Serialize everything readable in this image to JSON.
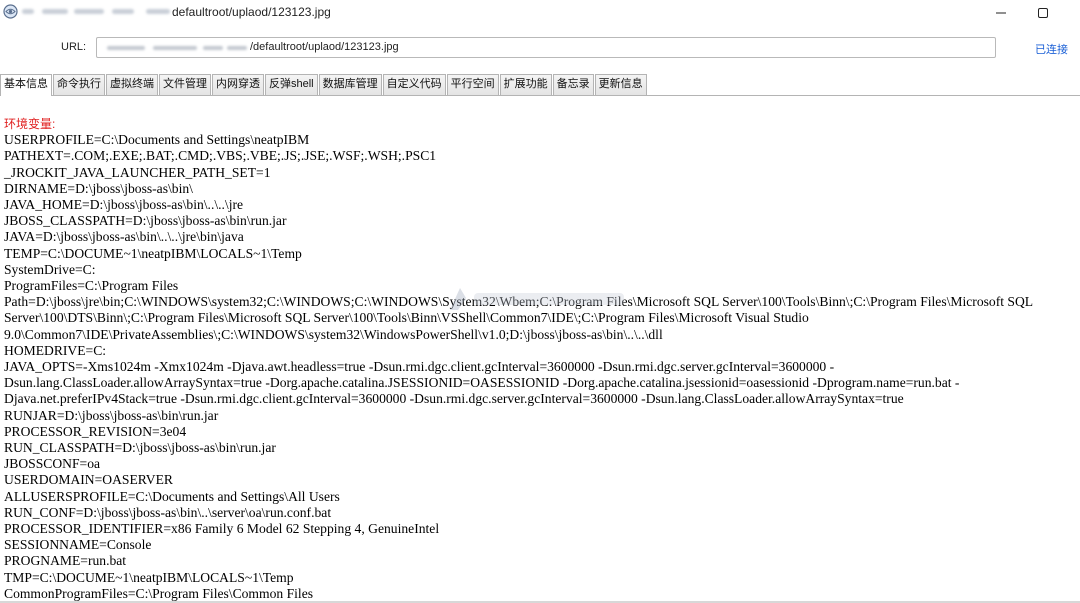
{
  "window": {
    "title_suffix": "defaultroot/uplaod/123123.jpg",
    "minimize_label": "minimize",
    "maximize_label": "maximize"
  },
  "url_bar": {
    "label": "URL:",
    "value_suffix": "/defaultroot/uplaod/123123.jpg",
    "status": "已连接"
  },
  "tabs": [
    {
      "label": "基本信息",
      "active": true
    },
    {
      "label": "命令执行"
    },
    {
      "label": "虚拟终端"
    },
    {
      "label": "文件管理"
    },
    {
      "label": "内网穿透"
    },
    {
      "label": "反弹shell"
    },
    {
      "label": "数据库管理"
    },
    {
      "label": "自定义代码"
    },
    {
      "label": "平行空间"
    },
    {
      "label": "扩展功能"
    },
    {
      "label": "备忘录"
    },
    {
      "label": "更新信息"
    }
  ],
  "content": {
    "section_title": "环境变量:",
    "env_lines": [
      "USERPROFILE=C:\\Documents and Settings\\neatpIBM",
      "PATHEXT=.COM;.EXE;.BAT;.CMD;.VBS;.VBE;.JS;.JSE;.WSF;.WSH;.PSC1",
      "_JROCKIT_JAVA_LAUNCHER_PATH_SET=1",
      "DIRNAME=D:\\jboss\\jboss-as\\bin\\",
      "JAVA_HOME=D:\\jboss\\jboss-as\\bin\\..\\..\\jre",
      "JBOSS_CLASSPATH=D:\\jboss\\jboss-as\\bin\\run.jar",
      "JAVA=D:\\jboss\\jboss-as\\bin\\..\\..\\jre\\bin\\java",
      "TEMP=C:\\DOCUME~1\\neatpIBM\\LOCALS~1\\Temp",
      "SystemDrive=C:",
      "ProgramFiles=C:\\Program Files",
      "Path=D:\\jboss\\jre\\bin;C:\\WINDOWS\\system32;C:\\WINDOWS;C:\\WINDOWS\\System32\\Wbem;C:\\Program Files\\Microsoft SQL Server\\100\\Tools\\Binn\\;C:\\Program Files\\Microsoft SQL Server\\100\\DTS\\Binn\\;C:\\Program Files\\Microsoft SQL Server\\100\\Tools\\Binn\\VSShell\\Common7\\IDE\\;C:\\Program Files\\Microsoft Visual Studio 9.0\\Common7\\IDE\\PrivateAssemblies\\;C:\\WINDOWS\\system32\\WindowsPowerShell\\v1.0;D:\\jboss\\jboss-as\\bin\\..\\..\\dll",
      "HOMEDRIVE=C:",
      "JAVA_OPTS=-Xms1024m -Xmx1024m -Djava.awt.headless=true -Dsun.rmi.dgc.client.gcInterval=3600000 -Dsun.rmi.dgc.server.gcInterval=3600000 -Dsun.lang.ClassLoader.allowArraySyntax=true -Dorg.apache.catalina.JSESSIONID=OASESSIONID -Dorg.apache.catalina.jsessionid=oasessionid -Dprogram.name=run.bat -Djava.net.preferIPv4Stack=true -Dsun.rmi.dgc.client.gcInterval=3600000 -Dsun.rmi.dgc.server.gcInterval=3600000 -Dsun.lang.ClassLoader.allowArraySyntax=true",
      "RUNJAR=D:\\jboss\\jboss-as\\bin\\run.jar",
      "PROCESSOR_REVISION=3e04",
      "RUN_CLASSPATH=D:\\jboss\\jboss-as\\bin\\run.jar",
      "JBOSSCONF=oa",
      "USERDOMAIN=OASERVER",
      "ALLUSERSPROFILE=C:\\Documents and Settings\\All Users",
      "RUN_CONF=D:\\jboss\\jboss-as\\bin\\..\\server\\oa\\run.conf.bat",
      "PROCESSOR_IDENTIFIER=x86 Family 6 Model 62 Stepping 4, GenuineIntel",
      "SESSIONNAME=Console",
      "PROGNAME=run.bat",
      "TMP=C:\\DOCUME~1\\neatpIBM\\LOCALS~1\\Temp",
      "CommonProgramFiles=C:\\Program Files\\Common Files"
    ]
  },
  "icons": {
    "app": "app-globe-icon",
    "minimize": "minimize-icon",
    "maximize": "maximize-icon",
    "watermark": "watermark-logo"
  },
  "colors": {
    "section_title": "#e02020",
    "status_link": "#1a5fd6",
    "tab_border": "#b4b4b4"
  }
}
